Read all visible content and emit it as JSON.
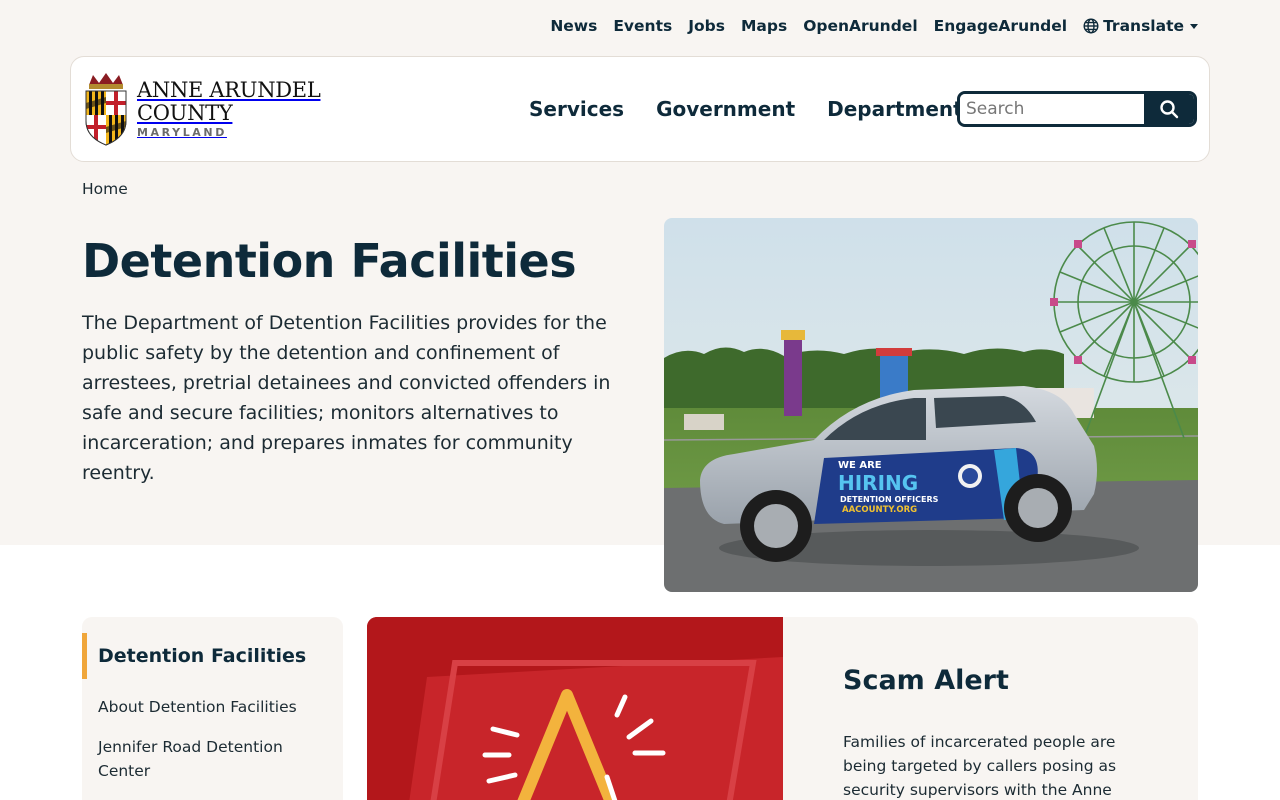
{
  "utility_nav": {
    "items": [
      "News",
      "Events",
      "Jobs",
      "Maps",
      "OpenArundel",
      "EngageArundel"
    ],
    "translate_label": "Translate"
  },
  "logo": {
    "line1": "ANNE ARUNDEL",
    "line2": "COUNTY",
    "line3": "MARYLAND"
  },
  "main_nav": {
    "items": [
      "Services",
      "Government",
      "Departments"
    ]
  },
  "search": {
    "placeholder": "Search"
  },
  "breadcrumb": {
    "home": "Home"
  },
  "hero": {
    "title": "Detention Facilities",
    "description": "The Department of Detention Facilities provides for the public safety by the detention and confinement of arrestees, pretrial detainees and convicted offenders in safe and secure facilities; monitors alternatives to incarceration; and prepares inmates for community reentry.",
    "image_text": {
      "line1": "WE ARE",
      "line2": "HIRING",
      "line3": "DETENTION OFFICERS",
      "line4": "AACOUNTY.ORG"
    }
  },
  "side_nav": {
    "heading": "Detention Facilities",
    "items": [
      "About Detention Facilities",
      "Jennifer Road Detention",
      "Center"
    ]
  },
  "scam_card": {
    "title": "Scam Alert",
    "text": "Families of incarcerated people are being targeted by callers posing as security supervisors with the Anne"
  },
  "colors": {
    "navy": "#0e2a3a",
    "cream": "#f8f5f2",
    "accent": "#f0a63a",
    "alert_red": "#b3171b"
  },
  "icons": {
    "translate": "globe-icon",
    "search": "search-icon",
    "alert": "warning-triangle-icon"
  }
}
